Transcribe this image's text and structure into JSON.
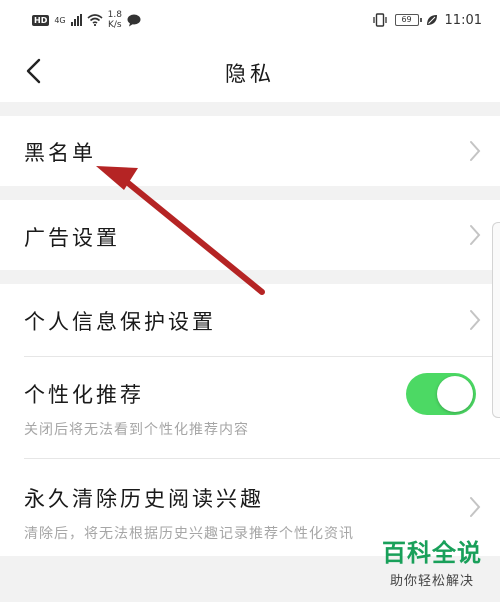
{
  "status_bar": {
    "hd": "HD",
    "signal": "4G",
    "speed_value": "1.8",
    "speed_unit": "K/s",
    "battery": "69",
    "time": "11:01"
  },
  "nav": {
    "title": "隐私"
  },
  "items": {
    "blacklist": {
      "label": "黑名单"
    },
    "ad_settings": {
      "label": "广告设置"
    },
    "personal_info": {
      "label": "个人信息保护设置"
    },
    "personalized": {
      "label": "个性化推荐",
      "desc": "关闭后将无法看到个性化推荐内容",
      "toggle_on": true
    },
    "clear_history": {
      "label": "永久清除历史阅读兴趣",
      "desc": "清除后，将无法根据历史兴趣记录推荐个性化资讯"
    }
  },
  "watermark": {
    "title": "百科全说",
    "subtitle": "助你轻松解决"
  },
  "colors": {
    "toggle_on": "#4cd964",
    "arrow": "#b52424",
    "watermark": "#19a05a"
  }
}
